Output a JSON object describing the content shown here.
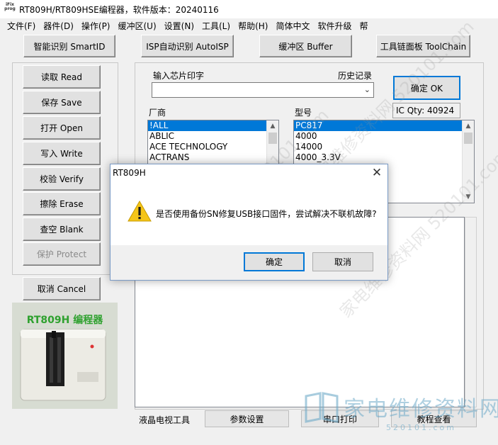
{
  "window": {
    "title": "RT809H/RT809HSE编程器，软件版本：20240116",
    "icon_text": "iFix prog"
  },
  "menu": [
    "文件(F)",
    "器件(D)",
    "操作(P)",
    "缓冲区(U)",
    "设置(N)",
    "工具(L)",
    "帮助(H)",
    "简体中文",
    "软件升级",
    "帮"
  ],
  "toolbar": {
    "smart_id": "智能识别 SmartID",
    "isp_auto": "ISP自动识别 AutoISP",
    "buffer": "缓冲区 Buffer",
    "toolchain": "工具链面板 ToolChain"
  },
  "left_buttons": {
    "read": "读取 Read",
    "save": "保存 Save",
    "open": "打开 Open",
    "write": "写入 Write",
    "verify": "校验 Verify",
    "erase": "擦除 Erase",
    "blank": "查空 Blank",
    "protect": "保护 Protect",
    "cancel": "取消 Cancel"
  },
  "chip_input": {
    "label": "输入芯片印字",
    "history_label": "历史记录",
    "value": "",
    "ok_button": "确定 OK",
    "ic_qty": "IC Qty: 40924"
  },
  "vendor": {
    "label": "厂商",
    "items": [
      "!ALL",
      "ABLIC",
      "ACE TECHNOLOGY",
      "ACTRANS"
    ],
    "selected_index": 0
  },
  "model": {
    "label": "型号",
    "items": [
      "PC817",
      "4000",
      "14000",
      "4000_3.3V"
    ],
    "selected_index": 0
  },
  "bottom_tabs": {
    "lcd_tools": "液晶电视工具",
    "params": "参数设置",
    "serial_print": "串口打印",
    "tutorial": "教程查看"
  },
  "device": {
    "caption": "RT809H 编程器"
  },
  "dialog": {
    "title": "RT809H",
    "message": "是否使用备份SN修复USB接口固件，尝试解决不联机故障?",
    "ok": "确定",
    "cancel": "取消"
  },
  "watermark": {
    "logo_text": "家电维修资料网",
    "logo_url": "520101.com",
    "diagonal_text": "家电维修资料网 520101.com"
  },
  "colors": {
    "selection": "#0078d7",
    "warning_icon": "#f5c518",
    "device_caption": "#2fa12f"
  }
}
